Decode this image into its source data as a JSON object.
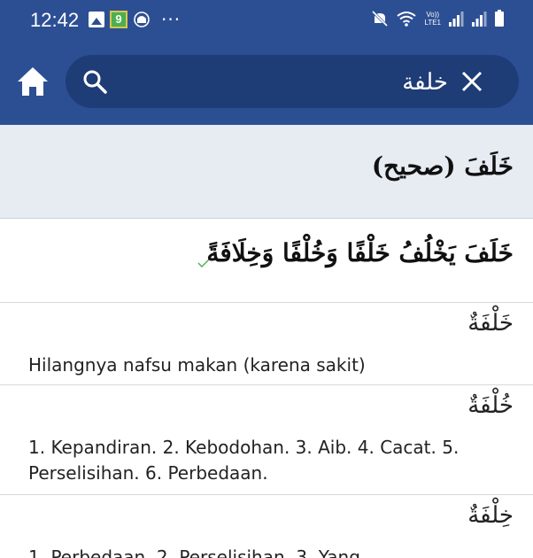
{
  "status_bar": {
    "time": "12:42",
    "badge_label": "9",
    "more": "···",
    "volte_line1": "Vo))",
    "volte_line2": "LTE1",
    "icons": [
      "gallery-icon",
      "app-badge-icon",
      "mosque-icon",
      "more-notifications-icon",
      "mute-icon",
      "wifi-icon",
      "volte-icon",
      "signal-icon",
      "signal-icon",
      "battery-icon"
    ]
  },
  "app_bar": {
    "home_icon": "home-icon",
    "search_icon": "search-icon",
    "query": "خلفة",
    "clear_icon": "close-icon"
  },
  "entry": {
    "header": "خَلَفَ (صحيح)",
    "forms": "خَلَفَ يَخْلُفُ خَلْفًا وَخُلْفًا وَخِلَافَةً",
    "check_icon": "check-icon"
  },
  "senses": [
    {
      "word": "خَلْفَةٌ",
      "definition": "Hilangnya nafsu makan (karena sakit)"
    },
    {
      "word": "خُلْفَةٌ",
      "definition": "1. Kepandiran. 2. Kebodohan. 3. Aib. 4. Cacat. 5. Perselisihan. 6. Perbedaan."
    },
    {
      "word": "خِلْفَةٌ",
      "definition": "1. Perbedaan. 2. Perselisihan. 3. Yang"
    }
  ],
  "colors": {
    "app_bar": "#2c4f94",
    "search_field": "#1e3c76",
    "header_bg": "#e6ecf2",
    "check": "#4caf50"
  }
}
